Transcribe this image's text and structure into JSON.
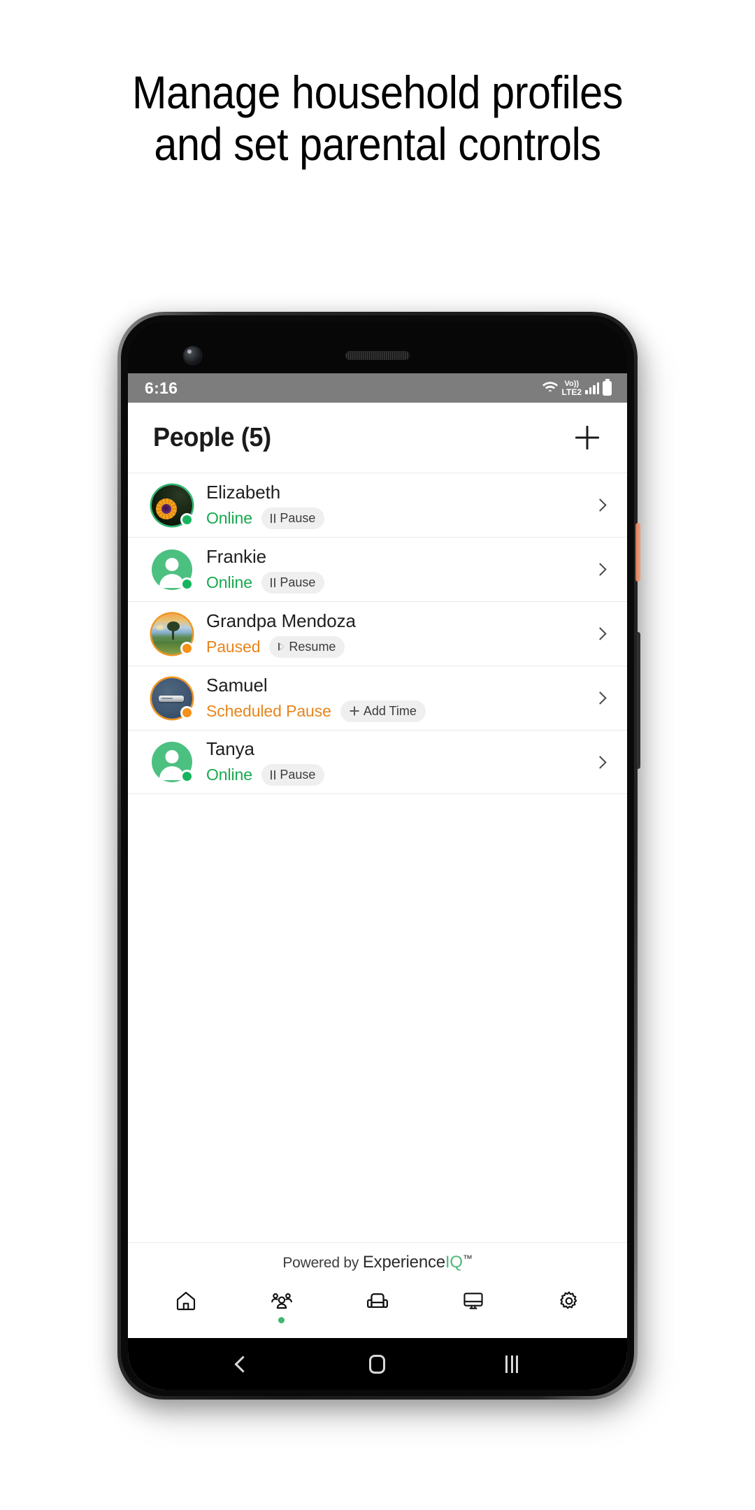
{
  "promo": {
    "headline_line1": "Manage household profiles",
    "headline_line2": "and set parental controls"
  },
  "status_bar": {
    "time": "6:16",
    "wifi_icon": "wifi-icon",
    "volte_top": "Vo))",
    "volte_bottom": "LTE2",
    "signal_icon": "signal-bars-icon",
    "battery_icon": "battery-full-icon"
  },
  "app_header": {
    "title": "People (5)",
    "add_label": "+",
    "add_icon": "plus-icon"
  },
  "people": [
    {
      "name": "Elizabeth",
      "status": "Online",
      "status_type": "online",
      "action_label": "Pause",
      "action_icon": "pause-icon",
      "avatar_type": "flower-photo",
      "chevron_icon": "chevron-right-icon"
    },
    {
      "name": "Frankie",
      "status": "Online",
      "status_type": "online",
      "action_label": "Pause",
      "action_icon": "pause-icon",
      "avatar_type": "person-placeholder",
      "chevron_icon": "chevron-right-icon"
    },
    {
      "name": "Grandpa Mendoza",
      "status": "Paused",
      "status_type": "paused",
      "action_label": "Resume",
      "action_icon": "play-icon",
      "avatar_type": "landscape-photo",
      "chevron_icon": "chevron-right-icon"
    },
    {
      "name": "Samuel",
      "status": "Scheduled Pause",
      "status_type": "paused",
      "action_label": "Add Time",
      "action_icon": "plus-icon",
      "avatar_type": "device-photo",
      "chevron_icon": "chevron-right-icon"
    },
    {
      "name": "Tanya",
      "status": "Online",
      "status_type": "online",
      "action_label": "Pause",
      "action_icon": "pause-icon",
      "avatar_type": "person-placeholder",
      "chevron_icon": "chevron-right-icon"
    }
  ],
  "brand": {
    "prefix": "Powered by ",
    "name": "Experience",
    "accent": "IQ",
    "tm": "™"
  },
  "bottom_nav": [
    {
      "name": "home",
      "icon": "home-icon",
      "active": false
    },
    {
      "name": "people",
      "icon": "people-icon",
      "active": true
    },
    {
      "name": "devices",
      "icon": "armchair-icon",
      "active": false
    },
    {
      "name": "network",
      "icon": "monitor-icon",
      "active": false
    },
    {
      "name": "settings",
      "icon": "gear-icon",
      "active": false
    }
  ],
  "android_nav": {
    "back_icon": "back-chevron-icon",
    "home_icon": "home-square-icon",
    "recents_icon": "recents-bars-icon"
  },
  "colors": {
    "online_green": "#17a84f",
    "paused_orange": "#e7851c",
    "brand_green": "#4fb87a",
    "status_bar_gray": "#7d7d7d",
    "power_button": "#e39070"
  }
}
